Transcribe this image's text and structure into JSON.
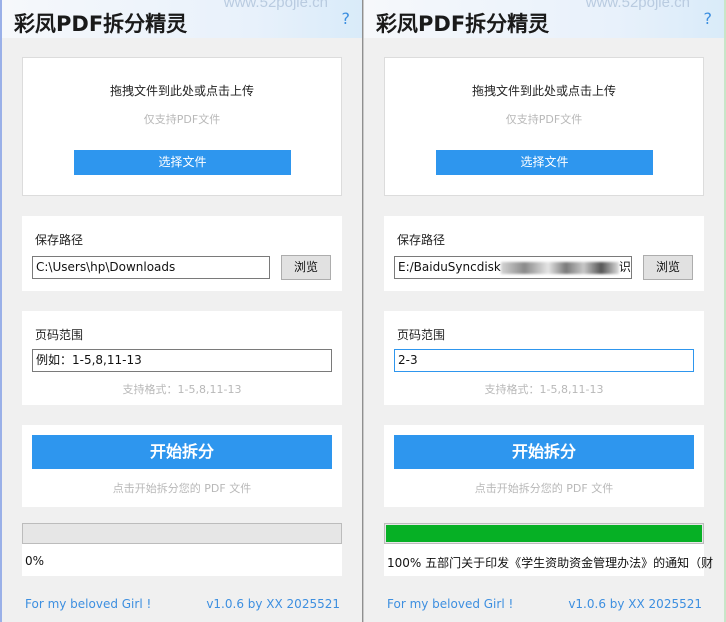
{
  "windows": [
    {
      "title": "彩凤PDF拆分精灵",
      "watermark": "www.52pojie.cn",
      "help": "?",
      "upload": {
        "hint": "拖拽文件到此处或点击上传",
        "sub": "仅支持PDF文件",
        "button": "选择文件"
      },
      "save": {
        "label": "保存路径",
        "path": "C:\\Users\\hp\\Downloads",
        "path_suffix": "",
        "browse": "浏览"
      },
      "range": {
        "label": "页码范围",
        "value": "例如：1-5,8,11-13",
        "format": "支持格式：1-5,8,11-13"
      },
      "split": {
        "button": "开始拆分",
        "note": "点击开始拆分您的 PDF 文件"
      },
      "progress": {
        "percent": 0,
        "status": "0%"
      },
      "footer": {
        "left": "For my beloved Girl !",
        "right": "v1.0.6 by XX 2025521"
      }
    },
    {
      "title": "彩凤PDF拆分精灵",
      "watermark": "www.52pojie.cn",
      "help": "?",
      "upload": {
        "hint": "拖拽文件到此处或点击上传",
        "sub": "仅支持PDF文件",
        "button": "选择文件"
      },
      "save": {
        "label": "保存路径",
        "path": "E:/BaiduSyncdisk",
        "path_suffix": "识",
        "browse": "浏览"
      },
      "range": {
        "label": "页码范围",
        "value": "2-3",
        "format": "支持格式：1-5,8,11-13"
      },
      "split": {
        "button": "开始拆分",
        "note": "点击开始拆分您的 PDF 文件"
      },
      "progress": {
        "percent": 100,
        "status": "100% 五部门关于印发《学生资助资金管理办法》的通知（财"
      },
      "footer": {
        "left": "For my beloved Girl !",
        "right": "v1.0.6 by XX 2025521"
      }
    }
  ],
  "colors": {
    "accent": "#2e96ee",
    "progress": "#06b025",
    "link": "#3d8fe0"
  }
}
